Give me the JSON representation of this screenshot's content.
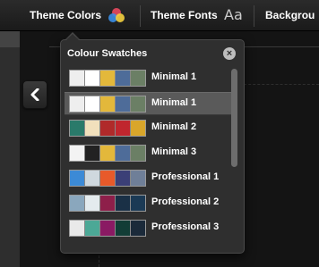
{
  "toolbar": {
    "theme_colors_label": "Theme Colors",
    "theme_fonts_label": "Theme Fonts",
    "fonts_icon_glyph": "Aa",
    "background_label": "Backgrou"
  },
  "panel": {
    "title": "Colour Swatches",
    "close_glyph": "×",
    "items": [
      {
        "label": "Minimal 1",
        "colors": [
          "#eeeeee",
          "#ffffff",
          "#e3b83b",
          "#4e6c99",
          "#6b7f65"
        ],
        "selected": false
      },
      {
        "label": "Minimal 1",
        "colors": [
          "#eeeeee",
          "#ffffff",
          "#e3b83b",
          "#4e6c99",
          "#6b7f65"
        ],
        "selected": true
      },
      {
        "label": "Minimal 2",
        "colors": [
          "#2a7a6a",
          "#f1e0bc",
          "#b02a2a",
          "#c0262e",
          "#d9a62a"
        ],
        "selected": false
      },
      {
        "label": "Minimal 3",
        "colors": [
          "#f3f3f3",
          "#222222",
          "#e3b83b",
          "#4e6c99",
          "#6b7f65"
        ],
        "selected": false
      },
      {
        "label": "Professional 1",
        "colors": [
          "#3c8ad6",
          "#cfd8de",
          "#e85a2a",
          "#3b3f77",
          "#6f7f98"
        ],
        "selected": false
      },
      {
        "label": "Professional 2",
        "colors": [
          "#8aa7bd",
          "#e4ebee",
          "#8e1f4a",
          "#1a3046",
          "#1b3a55"
        ],
        "selected": false
      },
      {
        "label": "Professional 3",
        "colors": [
          "#e9e9e9",
          "#4ca896",
          "#8a1a63",
          "#123d36",
          "#1b2a3a"
        ],
        "selected": false
      }
    ]
  },
  "colors": {
    "wheel_red": "#e84a5f",
    "wheel_yellow": "#f4d03f",
    "wheel_blue": "#3a8ee6",
    "wheel_green": "#4caf50",
    "wheel_purple": "#9b59b6"
  }
}
